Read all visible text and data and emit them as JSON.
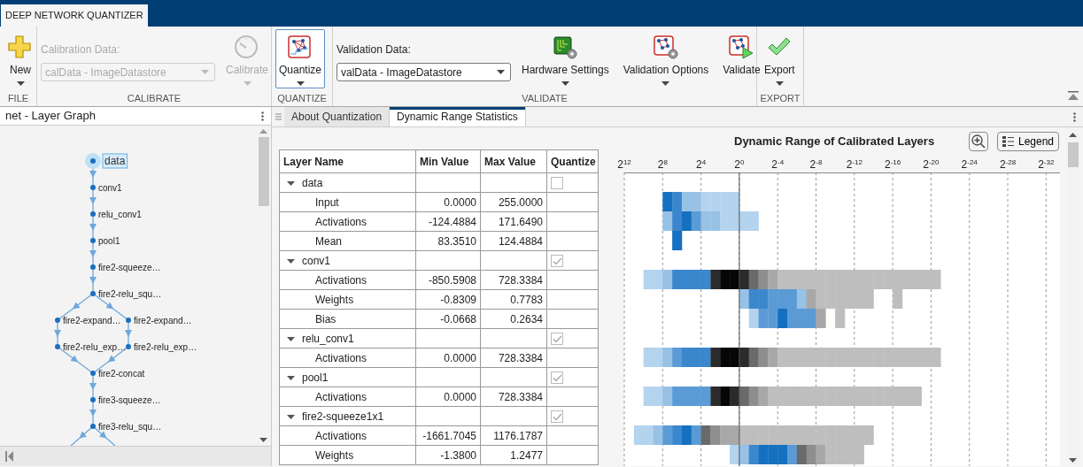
{
  "app_tab": "DEEP NETWORK QUANTIZER",
  "toolstrip": {
    "sections": [
      {
        "label": "FILE",
        "items": [
          {
            "kind": "button",
            "label": "New",
            "menu": true,
            "disabled": false,
            "selected": false
          }
        ]
      },
      {
        "label": "CALIBRATE",
        "items": [
          {
            "kind": "dropdown",
            "label": "Calibration Data:",
            "value": "calData - ImageDatastore",
            "disabled": true
          },
          {
            "kind": "button",
            "label": "Calibrate",
            "menu": true,
            "disabled": true,
            "selected": false
          }
        ]
      },
      {
        "label": "QUANTIZE",
        "items": [
          {
            "kind": "button",
            "label": "Quantize",
            "menu": true,
            "disabled": false,
            "selected": true
          }
        ]
      },
      {
        "label": "VALIDATE",
        "items": [
          {
            "kind": "dropdown",
            "label": "Validation Data:",
            "value": "valData - ImageDatastore",
            "disabled": false
          },
          {
            "kind": "button",
            "label": "Hardware Settings",
            "menu": true,
            "disabled": false,
            "selected": false
          },
          {
            "kind": "button",
            "label": "Validation Options",
            "menu": true,
            "disabled": false,
            "selected": false
          },
          {
            "kind": "button",
            "label": "Validate",
            "menu": false,
            "disabled": false,
            "selected": false
          }
        ]
      },
      {
        "label": "EXPORT",
        "items": [
          {
            "kind": "button",
            "label": "Export",
            "menu": true,
            "disabled": false,
            "selected": false
          }
        ]
      }
    ]
  },
  "layer_graph": {
    "title": "net - Layer Graph",
    "nodes": [
      {
        "label": "data",
        "selected": true
      },
      {
        "label": "conv1",
        "selected": false
      },
      {
        "label": "relu_conv1",
        "selected": false
      },
      {
        "label": "pool1",
        "selected": false
      },
      {
        "label": "fire2-squeeze…",
        "selected": false
      },
      {
        "label": "fire2-relu_squ…",
        "selected": false
      },
      {
        "label": "fire2-expand…",
        "selected": false
      },
      {
        "label": "fire2-expand…",
        "selected": false
      },
      {
        "label": "fire2-relu_exp…",
        "selected": false
      },
      {
        "label": "fire2-relu_exp…",
        "selected": false
      },
      {
        "label": "fire2-concat",
        "selected": false
      },
      {
        "label": "fire3-squeeze…",
        "selected": false
      },
      {
        "label": "fire3-relu_squ…",
        "selected": false
      }
    ]
  },
  "tabs": [
    {
      "label": "About Quantization",
      "selected": false
    },
    {
      "label": "Dynamic Range Statistics",
      "selected": true
    }
  ],
  "table": {
    "columns": [
      "Layer Name",
      "Min Value",
      "Max Value",
      "Quantize"
    ],
    "rows": [
      {
        "name": "data",
        "expanded": true,
        "quantize": false,
        "children": [
          {
            "name": "Input",
            "min": "0.0000",
            "max": "255.0000"
          },
          {
            "name": "Activations",
            "min": "-124.4884",
            "max": "171.6490"
          },
          {
            "name": "Mean",
            "min": "83.3510",
            "max": "124.4884"
          }
        ]
      },
      {
        "name": "conv1",
        "expanded": true,
        "quantize": true,
        "children": [
          {
            "name": "Activations",
            "min": "-850.5908",
            "max": "728.3384"
          },
          {
            "name": "Weights",
            "min": "-0.8309",
            "max": "0.7783"
          },
          {
            "name": "Bias",
            "min": "-0.0668",
            "max": "0.2634"
          }
        ]
      },
      {
        "name": "relu_conv1",
        "expanded": true,
        "quantize": true,
        "children": [
          {
            "name": "Activations",
            "min": "0.0000",
            "max": "728.3384"
          }
        ]
      },
      {
        "name": "pool1",
        "expanded": true,
        "quantize": true,
        "children": [
          {
            "name": "Activations",
            "min": "0.0000",
            "max": "728.3384"
          }
        ]
      },
      {
        "name": "fire2-squeeze1x1",
        "expanded": true,
        "quantize": true,
        "children": [
          {
            "name": "Activations",
            "min": "-1661.7045",
            "max": "1176.1787"
          },
          {
            "name": "Weights",
            "min": "-1.3800",
            "max": "1.2477"
          }
        ]
      }
    ]
  },
  "chart": {
    "title": "Dynamic Range of Calibrated Layers",
    "legend_button": "Legend",
    "ticks": [
      "2$^{12}$",
      "2$^{8}$",
      "2$^{4}$",
      "2$^{0}$",
      "2$^{-4}$",
      "2$^{-8}$",
      "2$^{-12}$",
      "2$^{-16}$",
      "2$^{-20}$",
      "2$^{-24}$",
      "2$^{-28}$",
      "2$^{-32}$"
    ]
  }
}
